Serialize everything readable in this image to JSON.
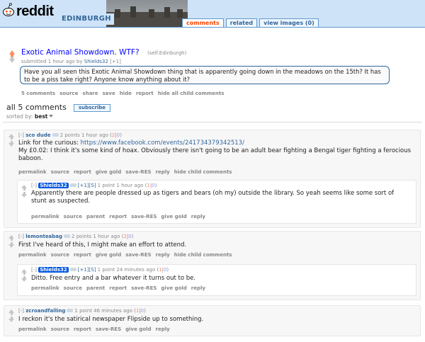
{
  "header": {
    "logo": "reddit",
    "subreddit": "EDINBURGH",
    "tabs": [
      "comments",
      "related",
      "view images (0)"
    ]
  },
  "post": {
    "title": "Exotic Animal Showdown. WTF?",
    "domain": "(self.Edinburgh)",
    "tagline_prefix": "submitted 1 hour ago by",
    "author": "Shields32",
    "tagline_suffix": "[+1]",
    "selftext": "Have you all seen this Exotic Animal Showdown thing that is apparently going down in the meadows on the 15th? It has to be a piss take right? Anyone know anything about it?",
    "buttons": [
      "5 comments",
      "source",
      "share",
      "save",
      "hide",
      "report",
      "hide all child comments"
    ]
  },
  "comments_header": {
    "count": "all 5 comments",
    "subscribe": "subscribe",
    "sort_label": "sorted by:",
    "sort_value": "best"
  },
  "comments": [
    {
      "expand": "[-]",
      "author": "sco dude",
      "meta": "2 points 1 hour ago",
      "score_open": "(",
      "score_up": "2",
      "score_sep": "|",
      "score_down": "0",
      "score_close": ")",
      "body_line1_prefix": "Link for the curious: ",
      "body_link": "https://www.facebook.com/events/241734379342513/",
      "body_line2": "My £0.02: I think it's some kind of hoax. Obviously there isn't going to be an adult bear fighting a Bengal tiger fighting a ferocious baboon.",
      "buttons": [
        "permalink",
        "source",
        "report",
        "give gold",
        "save-RES",
        "reply",
        "hide child comments"
      ]
    },
    {
      "expand": "[-]",
      "author": "Shields32",
      "flags": "[+1][S]",
      "meta": "1 point 1 hour ago",
      "score_open": "(",
      "score_up": "1",
      "score_sep": "|",
      "score_down": "0",
      "score_close": ")",
      "body": "Apparently there are people dressed up as tigers and bears (oh my) outside the library. So yeah seems like some sort of stunt as suspected.",
      "buttons": [
        "permalink",
        "source",
        "parent",
        "report",
        "save-RES",
        "give gold",
        "reply"
      ]
    },
    {
      "expand": "[-]",
      "author": "lemonteabag",
      "meta": "2 points 1 hour ago",
      "score_open": "(",
      "score_up": "2",
      "score_sep": "|",
      "score_down": "0",
      "score_close": ")",
      "body": "First I've heard of this, I might make an effort to attend.",
      "buttons": [
        "permalink",
        "source",
        "report",
        "give gold",
        "save-RES",
        "reply",
        "hide child comments"
      ]
    },
    {
      "expand": "[-]",
      "author": "Shields32",
      "flags": "[+1][S]",
      "meta": "1 point 24 minutes ago",
      "score_open": "(",
      "score_up": "1",
      "score_sep": "|",
      "score_down": "0",
      "score_close": ")",
      "body": "Ditto. Free entry and a bar whatever it turns out to be.",
      "buttons": [
        "permalink",
        "source",
        "parent",
        "report",
        "save-RES",
        "give gold",
        "reply"
      ]
    },
    {
      "expand": "[-]",
      "author": "zcroandfalling",
      "meta": "1 point 46 minutes ago",
      "score_open": "(",
      "score_up": "1",
      "score_sep": "|",
      "score_down": "0",
      "score_close": ")",
      "body": "I reckon it's the satirical newspaper Flipside up to something.",
      "buttons": [
        "permalink",
        "source",
        "report",
        "save-RES",
        "give gold",
        "reply"
      ]
    }
  ],
  "colors": {
    "header_bg": "#cee3f8",
    "link": "#0000ff",
    "upvote": "#ff8b60",
    "downvote": "#9494ff",
    "tab_selected": "#ff4500",
    "submitter_badge": "#0055df"
  }
}
